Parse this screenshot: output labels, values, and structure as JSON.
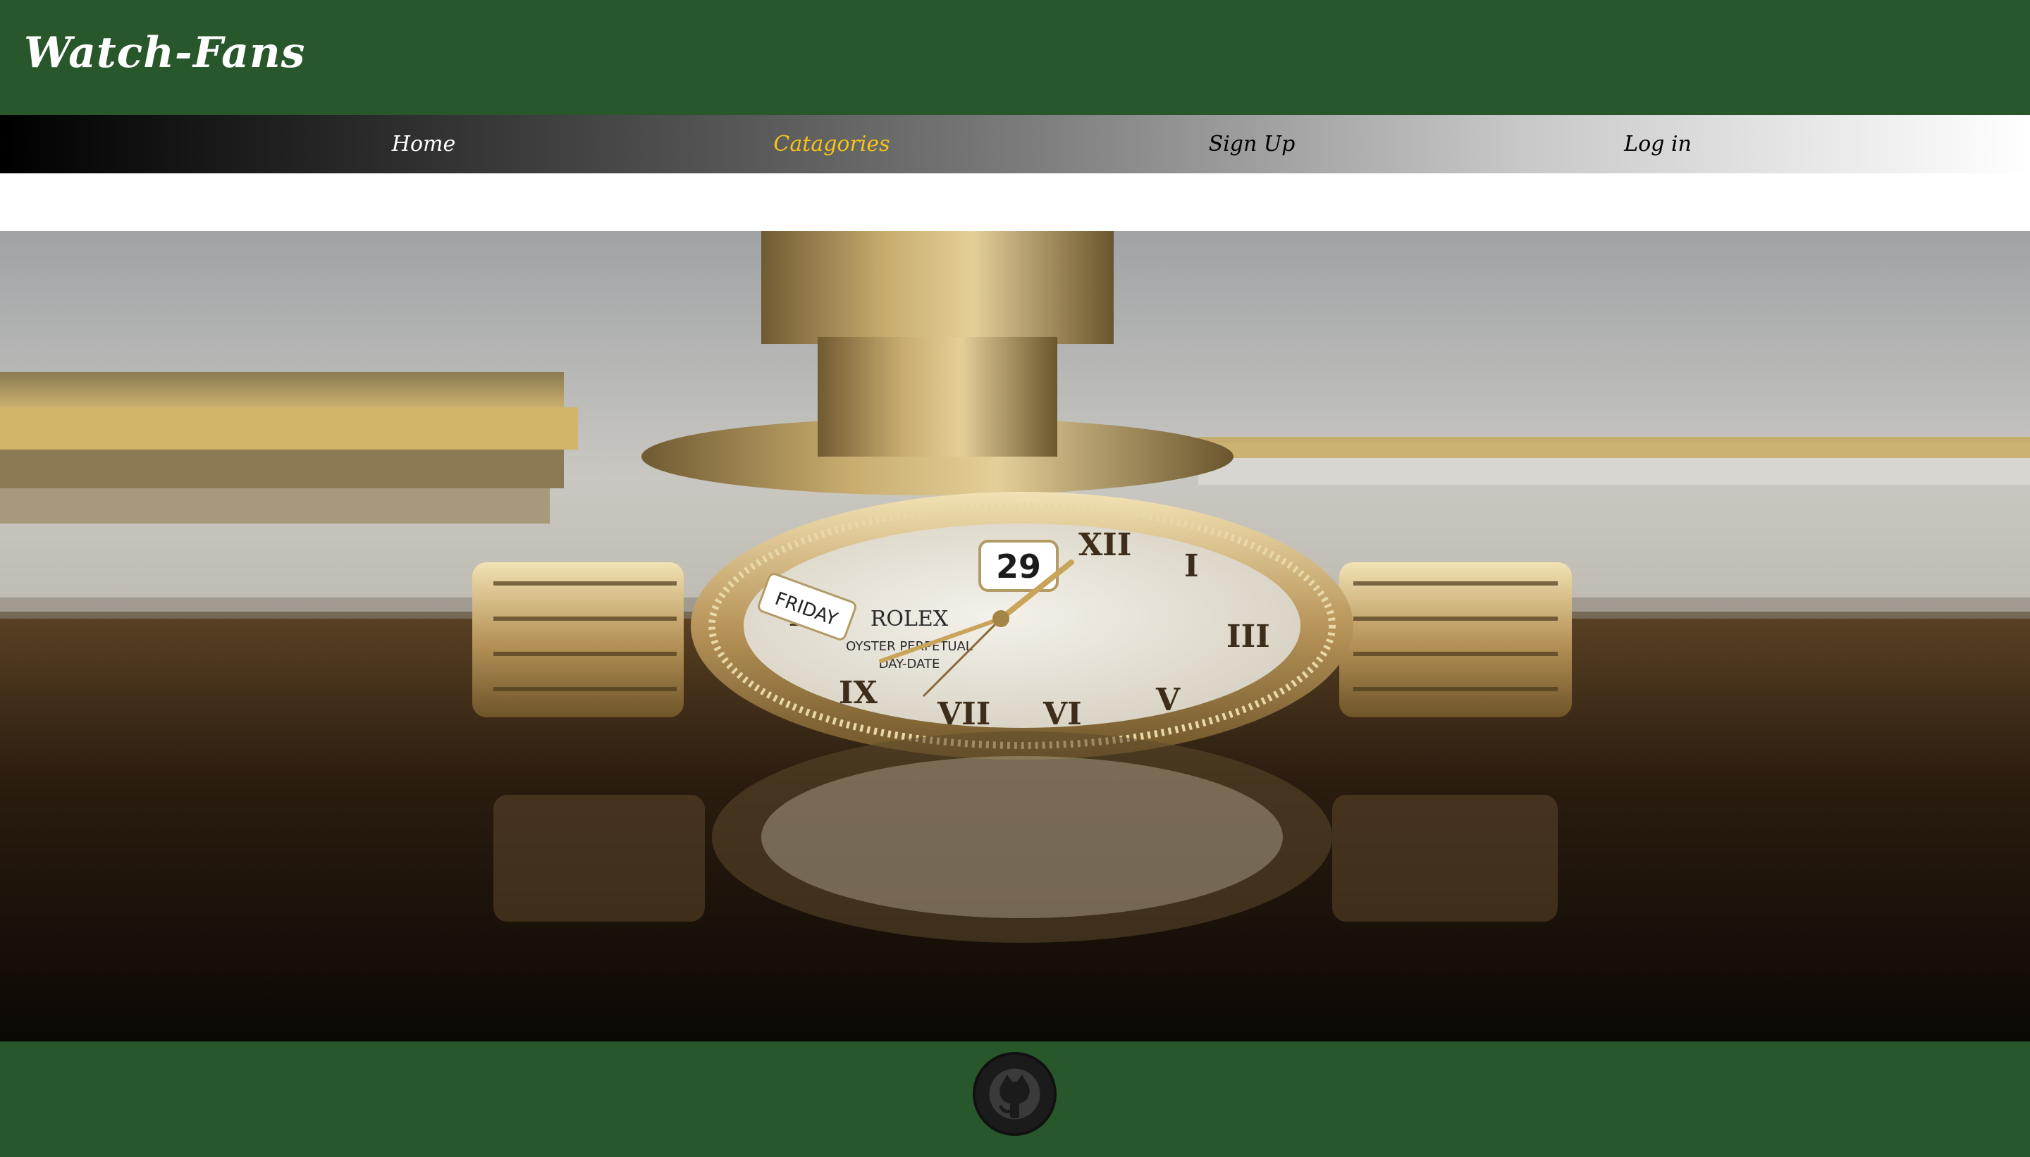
{
  "header": {
    "brand": "Watch-Fans",
    "background_color": "#28572c"
  },
  "nav": {
    "items": [
      {
        "label": "Home",
        "active": false
      },
      {
        "label": "Catagories",
        "active": true
      },
      {
        "label": "Sign Up",
        "active": false
      },
      {
        "label": "Log in",
        "active": false
      }
    ],
    "active_color": "#f5c518"
  },
  "hero": {
    "image": "gold-watch-photo",
    "dial": {
      "brand": "ROLEX",
      "model_line_1": "OYSTER PERPETUAL",
      "model_line_2": "DAY-DATE",
      "day": "FRIDAY",
      "date": "29"
    }
  },
  "footer": {
    "icon": "github-icon",
    "background_color": "#28572c"
  }
}
